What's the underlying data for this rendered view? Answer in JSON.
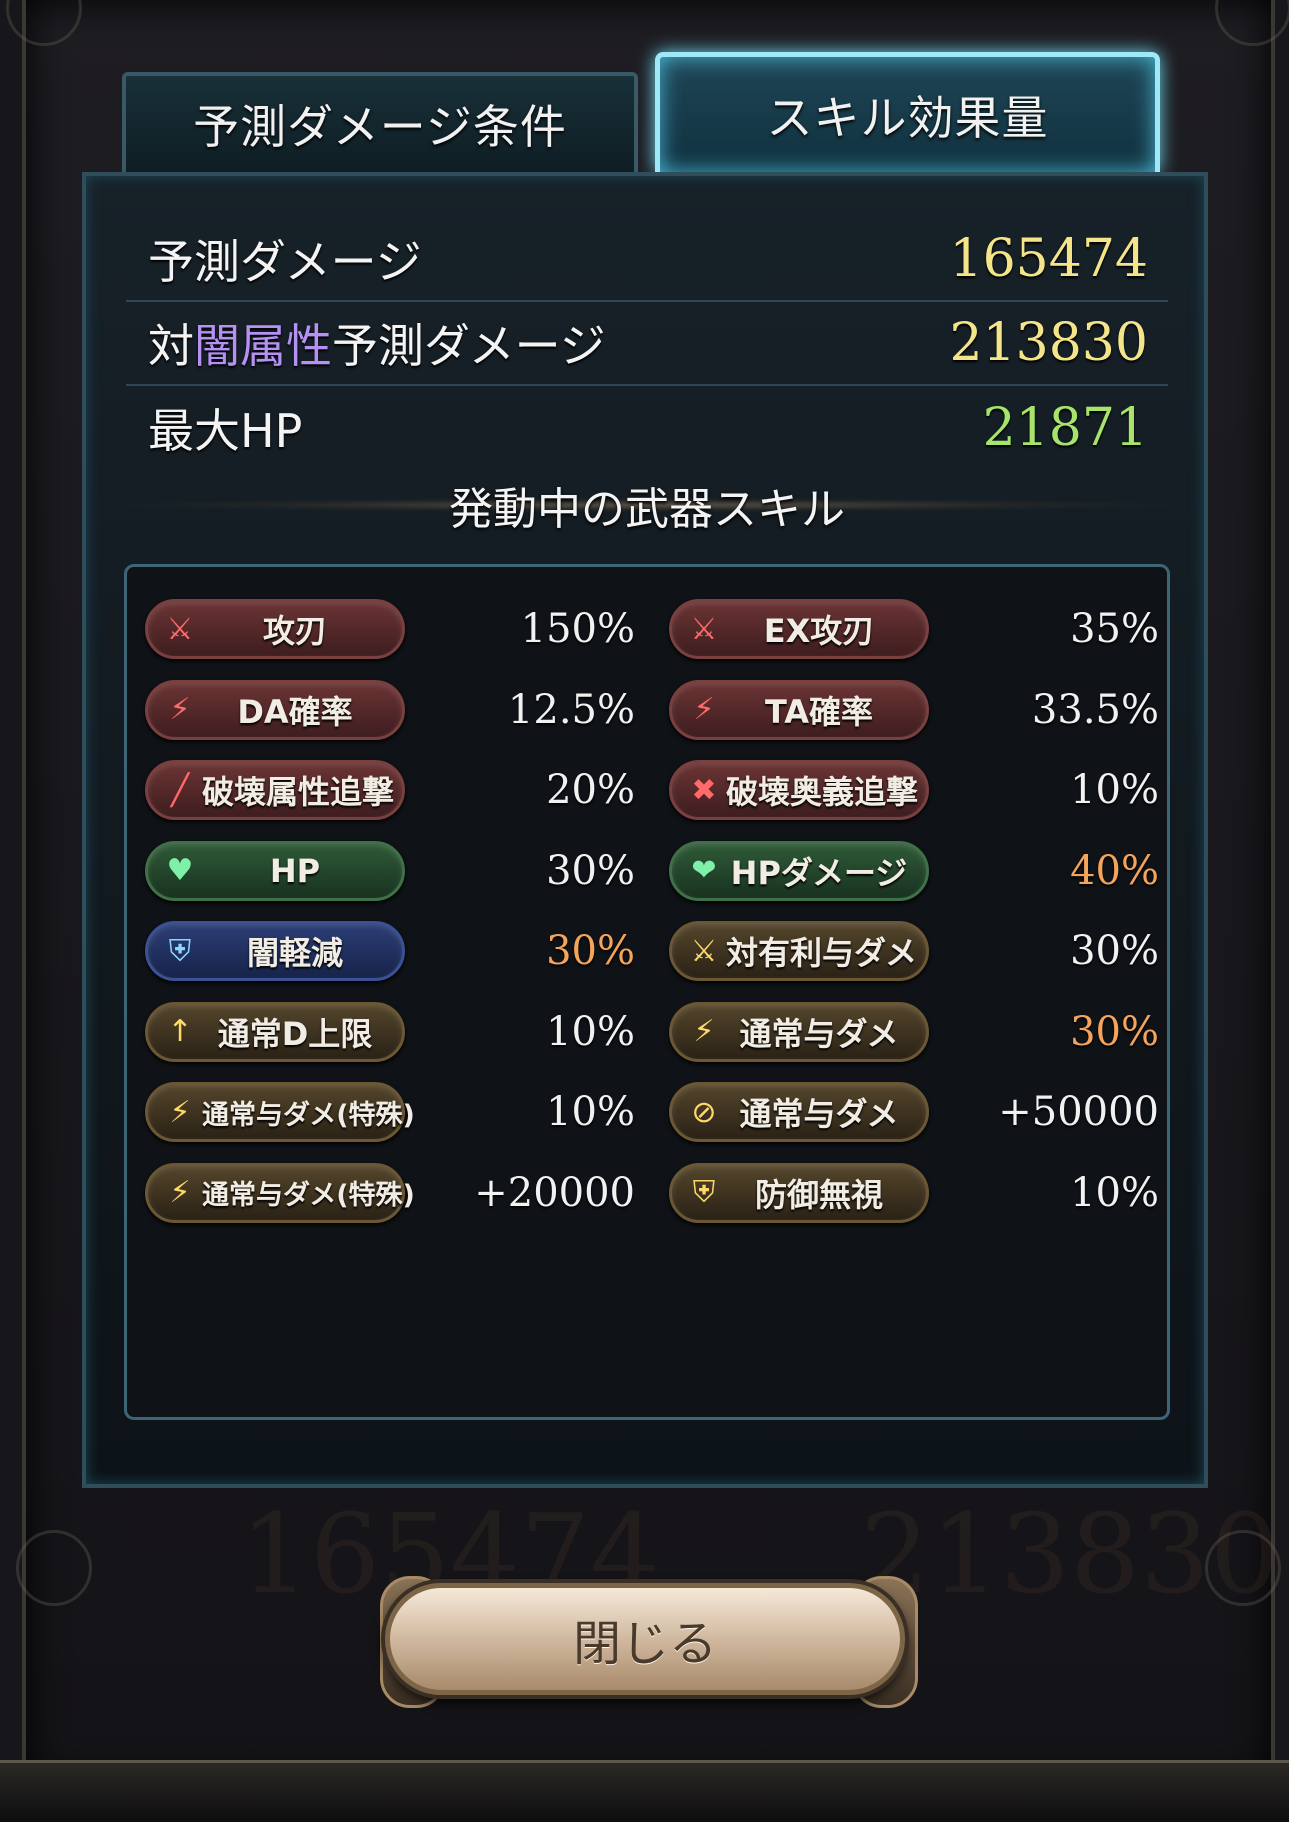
{
  "tabs": {
    "conditions": "予測ダメージ条件",
    "skill_effects": "スキル効果量"
  },
  "stats": {
    "predicted_label": "予測ダメージ",
    "predicted_value": "165474",
    "vs_dark_prefix": "対",
    "vs_dark_element": "闇属性",
    "vs_dark_suffix": "予測ダメージ",
    "vs_dark_value": "213830",
    "max_hp_label": "最大HP",
    "max_hp_value": "21871"
  },
  "section_title": "発動中の武器スキル",
  "skills": [
    {
      "label": "攻刃",
      "value": "150%",
      "type": "red",
      "icon": "sword-icon"
    },
    {
      "label": "EX攻刃",
      "value": "35%",
      "type": "red",
      "icon": "sword-icon"
    },
    {
      "label": "DA確率",
      "value": "12.5%",
      "type": "red",
      "icon": "double-attack-icon"
    },
    {
      "label": "TA確率",
      "value": "33.5%",
      "type": "red",
      "icon": "triple-attack-icon"
    },
    {
      "label": "破壊属性追撃",
      "value": "20%",
      "type": "red",
      "icon": "slash-icon"
    },
    {
      "label": "破壊奥義追撃",
      "value": "10%",
      "type": "red",
      "icon": "cross-slash-icon"
    },
    {
      "label": "HP",
      "value": "30%",
      "type": "green",
      "icon": "heart-icon"
    },
    {
      "label": "HPダメージ",
      "value": "40%",
      "type": "green",
      "icon": "broken-heart-icon"
    },
    {
      "label": "闇軽減",
      "value": "30%",
      "type": "blue",
      "icon": "shield-icon"
    },
    {
      "label": "対有利与ダメ",
      "value": "30%",
      "type": "gold",
      "icon": "lightning-sword-icon"
    },
    {
      "label": "通常D上限",
      "value": "10%",
      "type": "gold",
      "icon": "cap-up-icon"
    },
    {
      "label": "通常与ダメ",
      "value": "30%",
      "type": "gold",
      "icon": "lightning-icon"
    },
    {
      "label": "通常与ダメ(特殊)",
      "value": "10%",
      "type": "gold",
      "icon": "lightning-icon"
    },
    {
      "label": "通常与ダメ",
      "value": "+50000",
      "type": "gold",
      "icon": "circle-slash-icon"
    },
    {
      "label": "通常与ダメ(特殊)",
      "value": "+20000",
      "type": "gold",
      "icon": "lightning-icon"
    },
    {
      "label": "防御無視",
      "value": "10%",
      "type": "gold",
      "icon": "shield-break-icon"
    }
  ],
  "close_button": "閉じる",
  "colors": {
    "value_yellow": "#f4e58a",
    "value_green": "#a6e46a",
    "value_orange": "#f5a45c",
    "value_white": "#f1f1f1",
    "element_purple": "#b491f2"
  }
}
